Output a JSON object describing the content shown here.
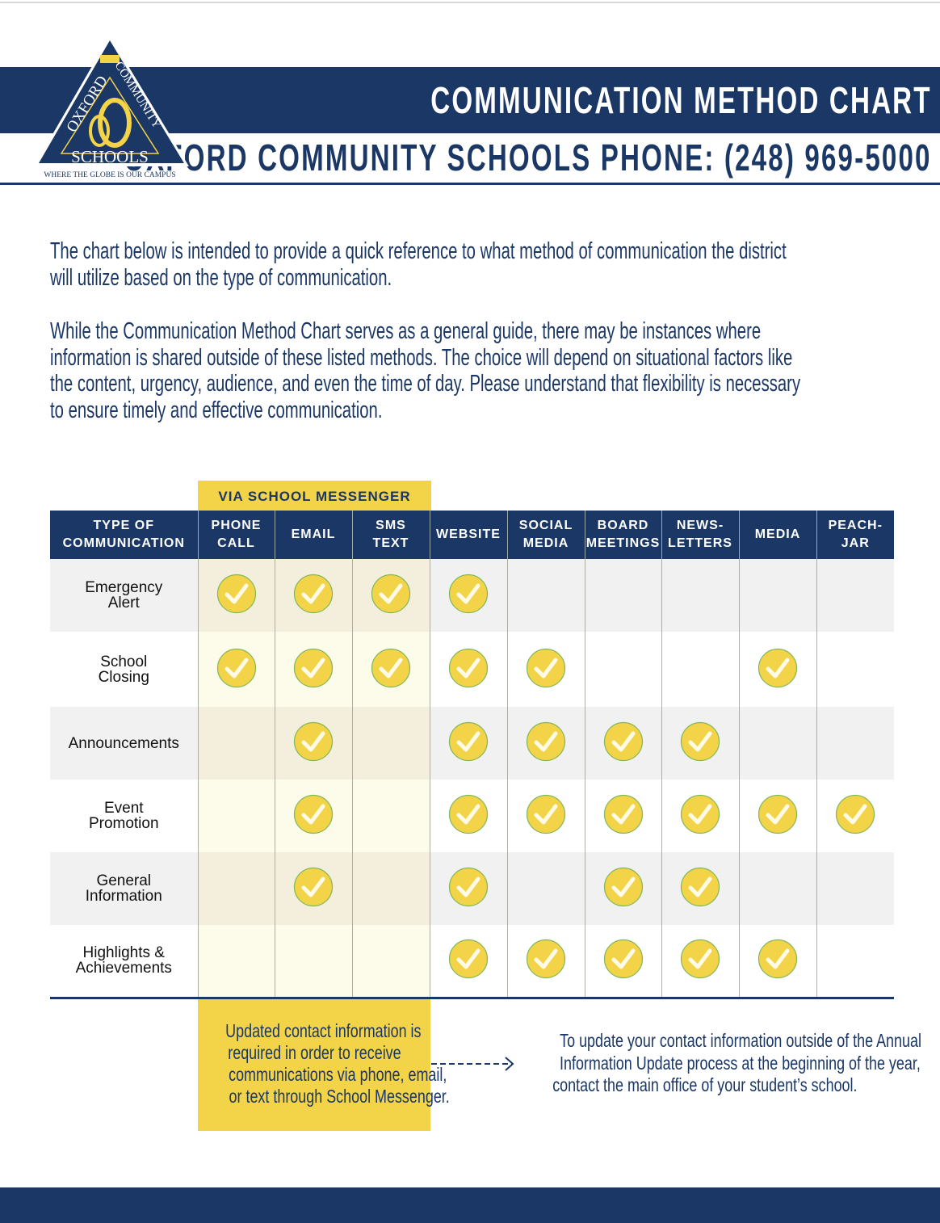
{
  "header": {
    "title": "COMMUNICATION METHOD CHART",
    "phone_line": "OXFORD COMMUNITY SCHOOLS PHONE: (248) 969-5000",
    "logo": {
      "top": "OXFORD COMMUNITY",
      "bottom": "SCHOOLS",
      "tagline": "WHERE THE GLOBE IS OUR CAMPUS"
    }
  },
  "intro": {
    "p1": [
      "The chart below is intended to provide a quick reference to what method of communication the district",
      "will utilize based on the type of communication."
    ],
    "p2": [
      "While the Communication Method Chart serves as a general guide, there may be instances where",
      "information is shared outside of these listed methods. The choice will depend on situational factors like",
      "the content, urgency, audience, and even the time of day. Please understand that flexibility is necessary",
      "to ensure timely and effective communication."
    ]
  },
  "table": {
    "group_label": "VIA SCHOOL MESSENGER",
    "columns": [
      [
        "TYPE OF",
        "COMMUNICATION"
      ],
      [
        "PHONE",
        "CALL"
      ],
      [
        "EMAIL"
      ],
      [
        "SMS",
        "TEXT"
      ],
      [
        "WEBSITE"
      ],
      [
        "SOCIAL",
        "MEDIA"
      ],
      [
        "BOARD",
        "MEETINGS"
      ],
      [
        "NEWS-",
        "LETTERS"
      ],
      [
        "MEDIA"
      ],
      [
        "PEACH-",
        "JAR"
      ]
    ],
    "rows": [
      {
        "label": [
          "Emergency",
          "Alert"
        ],
        "checks": [
          1,
          1,
          1,
          1,
          0,
          0,
          0,
          0,
          0
        ]
      },
      {
        "label": [
          "School",
          "Closing"
        ],
        "checks": [
          1,
          1,
          1,
          1,
          1,
          0,
          0,
          1,
          0
        ]
      },
      {
        "label": [
          "Announcements"
        ],
        "checks": [
          0,
          1,
          0,
          1,
          1,
          1,
          1,
          0,
          0
        ]
      },
      {
        "label": [
          "Event",
          "Promotion"
        ],
        "checks": [
          0,
          1,
          0,
          1,
          1,
          1,
          1,
          1,
          1
        ]
      },
      {
        "label": [
          "General",
          "Information"
        ],
        "checks": [
          0,
          1,
          0,
          1,
          0,
          1,
          1,
          0,
          0
        ]
      },
      {
        "label": [
          "Highlights &",
          "Achievements"
        ],
        "checks": [
          0,
          0,
          0,
          1,
          1,
          1,
          1,
          1,
          0
        ]
      }
    ]
  },
  "note": [
    "Updated contact information is",
    "required in order to receive",
    "communications via phone, email,",
    "or text through School Messenger."
  ],
  "right_note": [
    "To update your contact information outside of the Annual",
    "Information Update process at the beginning of the year,",
    "contact the main office of your student’s school."
  ],
  "colors": {
    "navy": "#1b3765",
    "yellow": "#f3d348"
  }
}
